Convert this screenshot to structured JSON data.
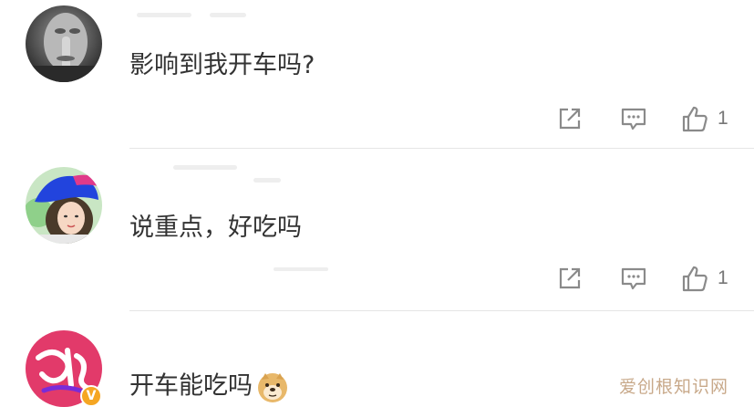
{
  "comments": [
    {
      "text": "影响到我开车吗?",
      "likes": "1",
      "avatar_icon": "finger-to-lips-avatar"
    },
    {
      "text": "说重点，好吃吗",
      "likes": "1",
      "avatar_icon": "blue-cap-avatar"
    },
    {
      "text": "开车能吃吗",
      "likes": "",
      "avatar_icon": "calligraphy-avatar",
      "emoji": "doge-emoji"
    }
  ],
  "watermark": "爱创根知识网",
  "colors": {
    "text": "#333333",
    "icon": "#888888",
    "divider": "#e5e5e5",
    "verified_badge": "#f5a623",
    "watermark": "#c8a98a"
  }
}
